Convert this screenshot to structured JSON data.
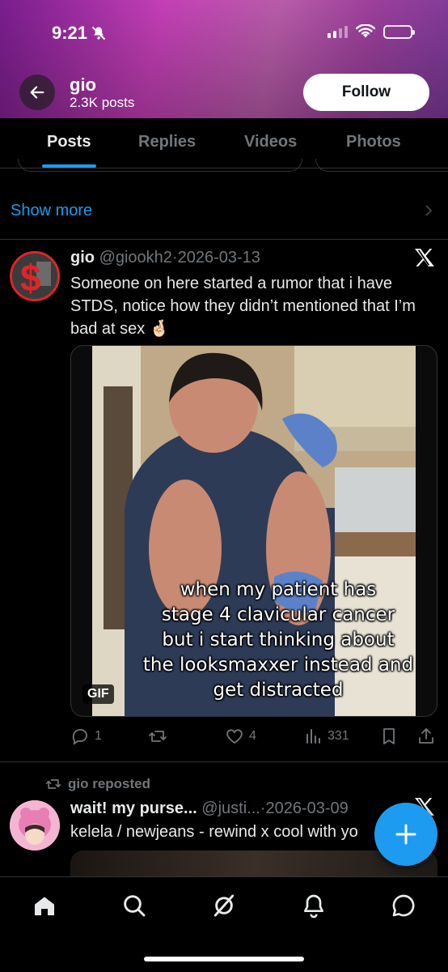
{
  "status_bar": {
    "time": "9:21"
  },
  "profile": {
    "name": "gio",
    "posts_count": "2.3K posts",
    "follow_label": "Follow"
  },
  "tabs": [
    {
      "label": "Posts",
      "active": true
    },
    {
      "label": "Replies",
      "active": false
    },
    {
      "label": "Videos",
      "active": false
    },
    {
      "label": "Photos",
      "active": false
    }
  ],
  "show_more": "Show more",
  "tweet": {
    "name": "gio",
    "handle": "@giookh2",
    "date": "2026-03-13",
    "text": "Someone on here started a rumor that i have STDS, notice how they didn’t mentioned that I’m bad at sex 🤞🏻",
    "media": {
      "badge": "GIF",
      "caption_lines": [
        "when my patient has",
        "stage 4 clavicular cancer",
        "but i start thinking about",
        "the looksmaxxer instead and",
        "get distracted"
      ]
    },
    "stats": {
      "replies": "1",
      "reposts": "",
      "likes": "4",
      "views": "331"
    }
  },
  "repost": {
    "label": "gio reposted",
    "name": "wait! my purse...",
    "handle": "@justi...",
    "date": "2026-03-09",
    "text": "kelela / newjeans - rewind x cool with yo"
  },
  "bottom_nav": [
    "home-icon",
    "search-icon",
    "grok-icon",
    "notifications-icon",
    "messages-icon"
  ],
  "colors": {
    "accent": "#1d9bf0",
    "background": "#000000",
    "muted": "#71767b"
  }
}
